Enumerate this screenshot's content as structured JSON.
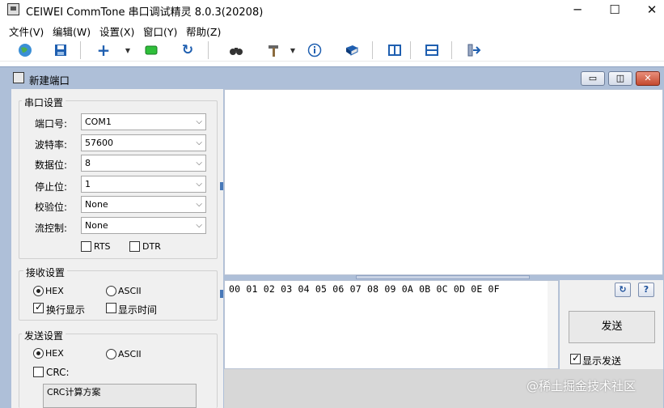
{
  "window": {
    "title": "CEIWEI CommTone 串口调试精灵 8.0.3(20208)",
    "min": "─",
    "max": "☐",
    "close": "✕"
  },
  "menu": [
    "文件(V)",
    "编辑(W)",
    "设置(X)",
    "窗口(Y)",
    "帮助(Z)"
  ],
  "child": {
    "title": "新建端口"
  },
  "serial": {
    "group_title": "串口设置",
    "port_label": "端口号:",
    "port_value": "COM1",
    "baud_label": "波特率:",
    "baud_value": "57600",
    "databits_label": "数据位:",
    "databits_value": "8",
    "stopbits_label": "停止位:",
    "stopbits_value": "1",
    "parity_label": "校验位:",
    "parity_value": "None",
    "flow_label": "流控制:",
    "flow_value": "None",
    "rts_label": "RTS",
    "dtr_label": "DTR"
  },
  "receive": {
    "group_title": "接收设置",
    "hex_label": "HEX",
    "ascii_label": "ASCII",
    "wrap_label": "换行显示",
    "time_label": "显示时间"
  },
  "send": {
    "group_title": "发送设置",
    "hex_label": "HEX",
    "ascii_label": "ASCII",
    "crc_label": "CRC:",
    "crc_select_value": "CRC计算方案",
    "content": "00 01 02 03 04 05 06 07 08 09 0A 0B 0C 0D 0E 0F",
    "send_button": "发送",
    "show_send_label": "显示发送"
  },
  "watermark": "@稀土掘金技术社区"
}
